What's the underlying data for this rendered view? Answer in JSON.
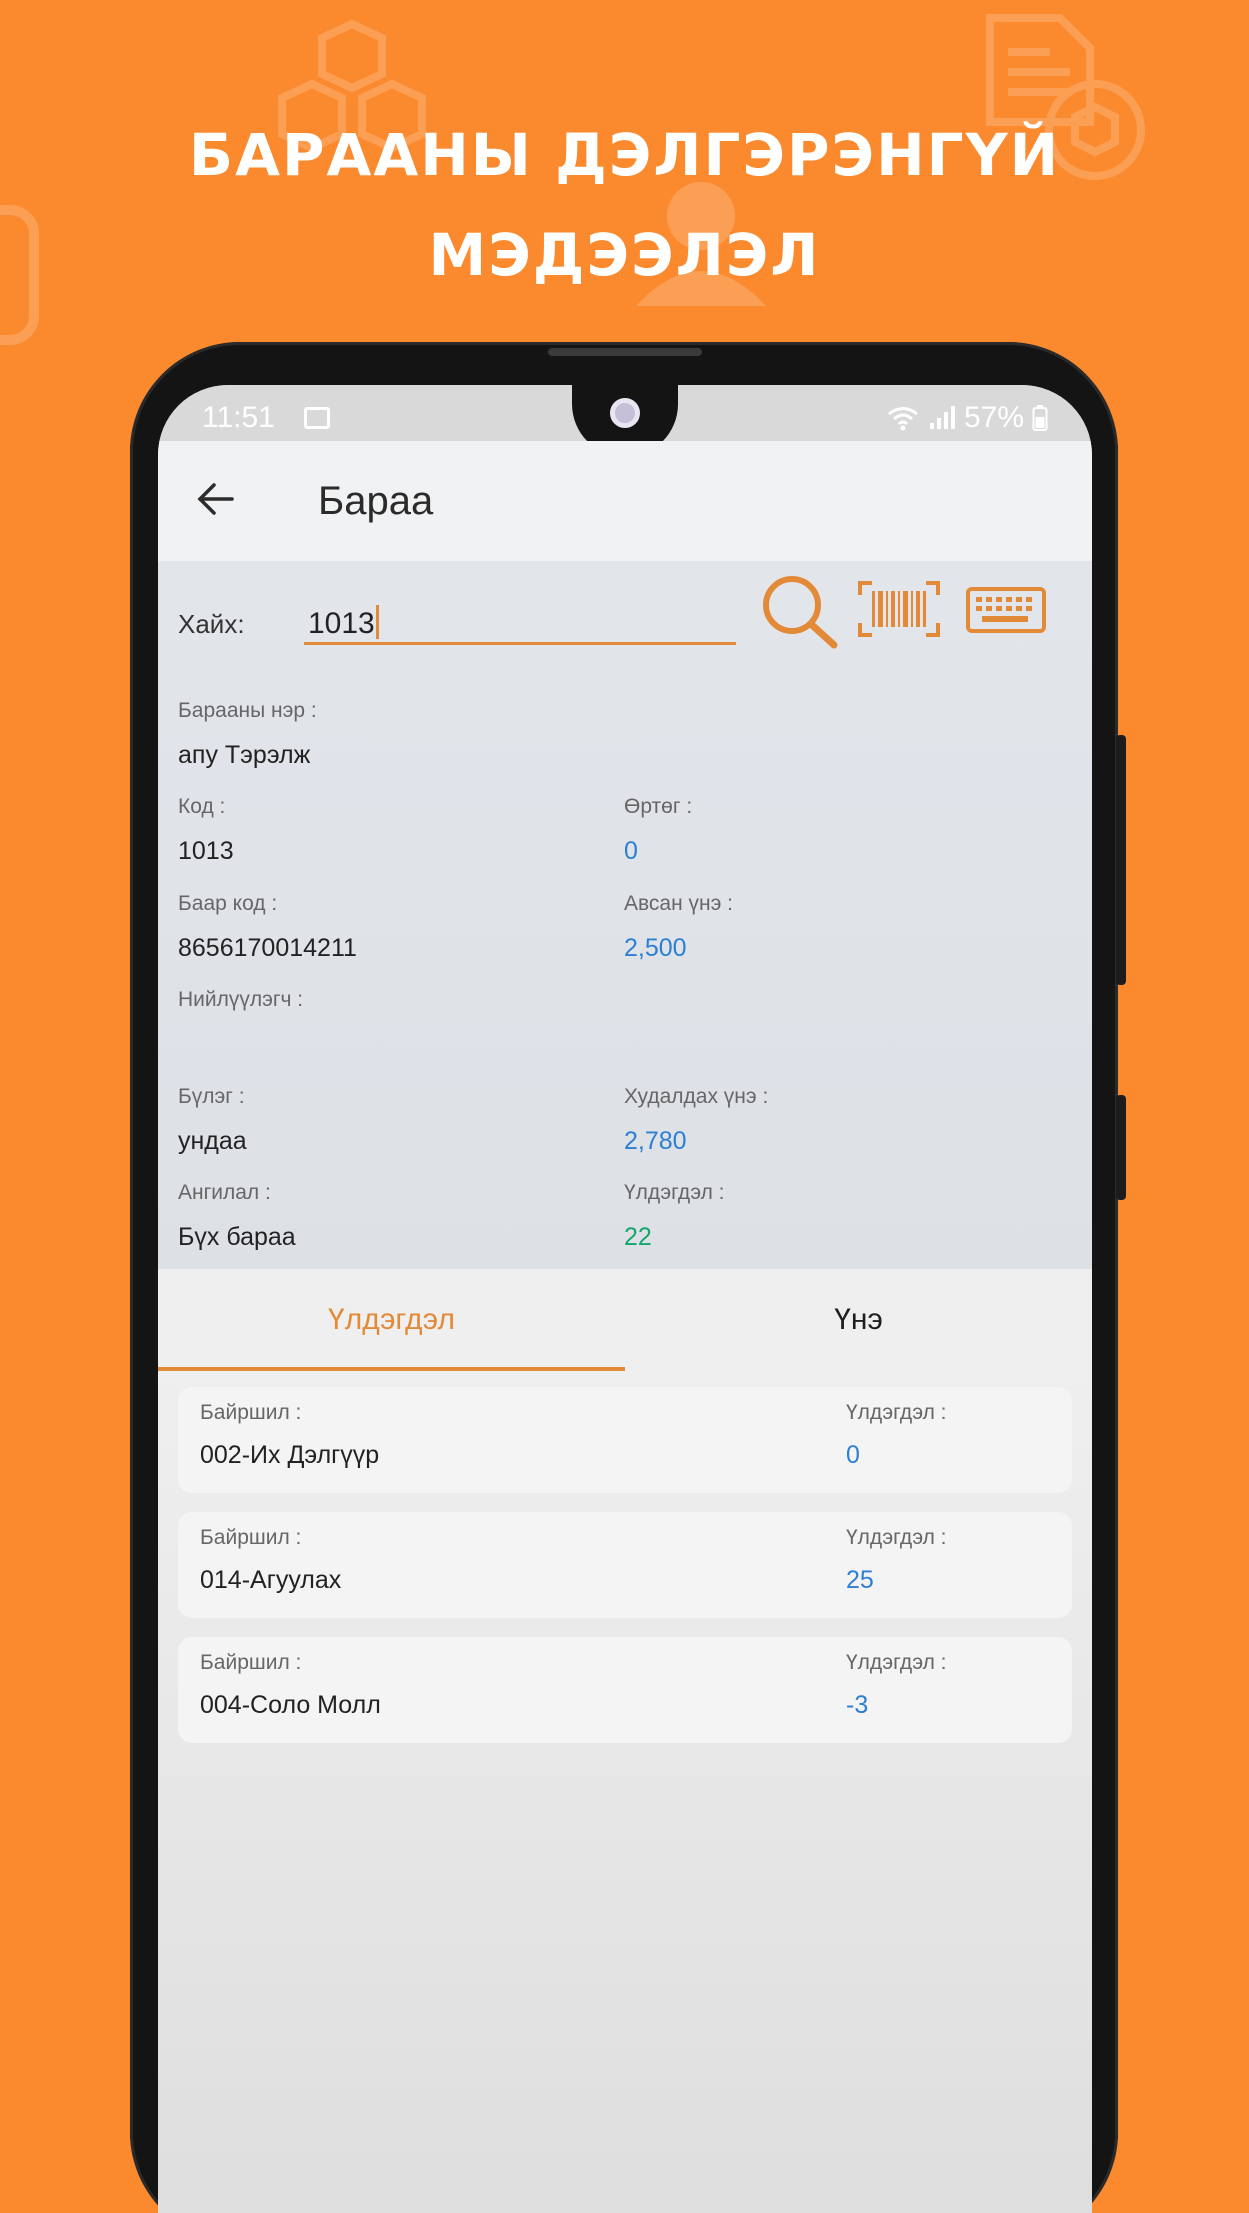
{
  "promo": {
    "title_line1": "БАРААНЫ ДЭЛГЭРЭНГҮЙ",
    "title_line2": "МЭДЭЭЛЭЛ"
  },
  "status_bar": {
    "time": "11:51",
    "battery": "57%"
  },
  "app_bar": {
    "title": "Бараа"
  },
  "search": {
    "label": "Хайх:",
    "value": "1013"
  },
  "product": {
    "name_label": "Барааны нэр :",
    "name_value": "апу Тэрэлж",
    "code_label": "Код :",
    "code_value": "1013",
    "cost_label": "Өртөг :",
    "cost_value": "0",
    "barcode_label": "Баар код :",
    "barcode_value": "8656170014211",
    "purchase_price_label": "Авсан үнэ :",
    "purchase_price_value": "2,500",
    "supplier_label": "Нийлүүлэгч :",
    "supplier_value": "",
    "group_label": "Бүлэг :",
    "group_value": "ундаа",
    "sale_price_label": "Худалдах үнэ :",
    "sale_price_value": "2,780",
    "category_label": "Ангилал :",
    "category_value": "Бүх бараа",
    "stock_label": "Үлдэгдэл :",
    "stock_value": "22"
  },
  "tabs": [
    {
      "label": "Үлдэгдэл",
      "active": true
    },
    {
      "label": "Үнэ",
      "active": false
    }
  ],
  "stock_list": [
    {
      "location_label": "Байршил :",
      "location": "002-Их Дэлгүүр",
      "qty_label": "Үлдэгдэл :",
      "qty": "0"
    },
    {
      "location_label": "Байршил :",
      "location": "014-Агуулах",
      "qty_label": "Үлдэгдэл :",
      "qty": "25"
    },
    {
      "location_label": "Байршил :",
      "location": "004-Соло Молл",
      "qty_label": "Үлдэгдэл :",
      "qty": "-3"
    }
  ],
  "colors": {
    "background": "#fb8a2e",
    "accent": "#e38a38",
    "value_blue": "#2d7fd3",
    "value_green": "#14a66b"
  },
  "icons": [
    "back-arrow-icon",
    "search-icon",
    "barcode-scan-icon",
    "keyboard-icon",
    "wifi-icon",
    "signal-icon",
    "battery-icon",
    "gallery-icon"
  ]
}
